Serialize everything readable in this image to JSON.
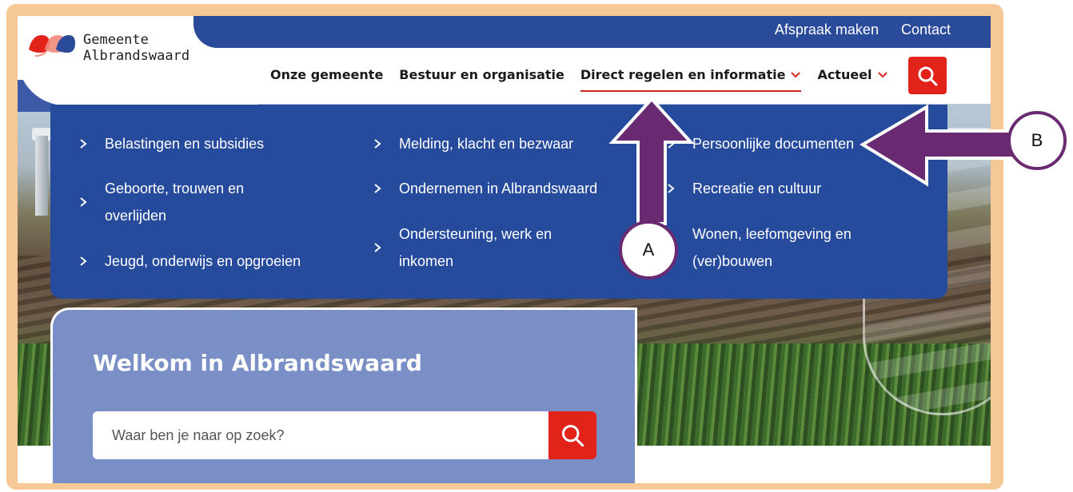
{
  "topbar": {
    "links": [
      "Afspraak maken",
      "Contact"
    ]
  },
  "logo": {
    "line1": "Gemeente",
    "line2": "Albrandswaard"
  },
  "nav": {
    "items": [
      "Onze gemeente",
      "Bestuur en organisatie",
      "Direct regelen en informatie",
      "Actueel"
    ],
    "active_index": 2
  },
  "mega_menu": {
    "col1": [
      "Belastingen en subsidies",
      "Geboorte, trouwen en overlijden",
      "Jeugd, onderwijs en opgroeien"
    ],
    "col2": [
      "Melding, klacht en bezwaar",
      "Ondernemen in Albrandswaard",
      "Ondersteuning, werk en inkomen"
    ],
    "col3": [
      "Persoonlijke documenten",
      "Recreatie en cultuur",
      "Wonen, leefomgeving en (ver)bouwen"
    ]
  },
  "welcome": {
    "title": "Welkom in Albrandswaard",
    "search_placeholder": "Waar ben je naar op zoek?"
  },
  "annotations": {
    "a": "A",
    "b": "B"
  },
  "colors": {
    "brand_blue": "#274b9c",
    "accent_red": "#e2231a",
    "annotation_purple": "#6a2a72",
    "frame_orange": "#f5c896"
  },
  "icons": [
    "search-icon",
    "chevron-down-icon",
    "chevron-right-icon",
    "logo-mark"
  ]
}
